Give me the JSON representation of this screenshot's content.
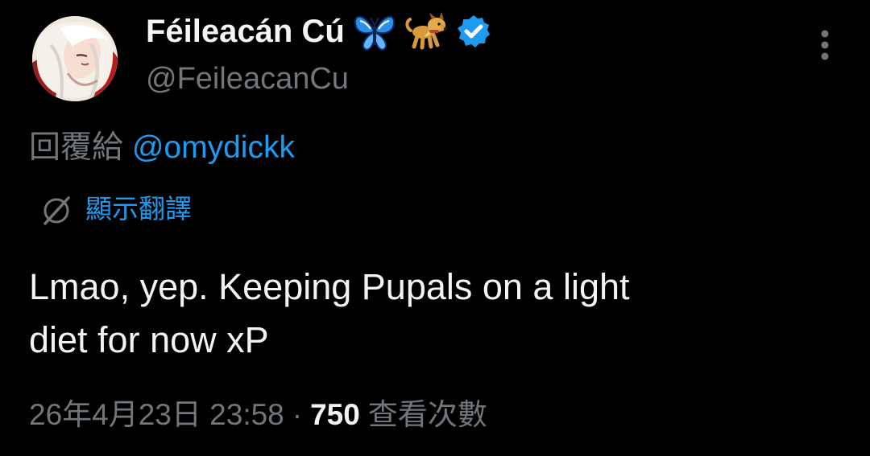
{
  "author": {
    "display_name": "Féileacán Cú",
    "handle": "@FeileacanCu",
    "name_badges": [
      "butterfly-icon",
      "dog-icon",
      "verified-badge-icon"
    ]
  },
  "reply": {
    "prefix": "回覆給 ",
    "mention": "@omydickk"
  },
  "translation": {
    "label": "顯示翻譯",
    "icon": "globe-slash-icon"
  },
  "tweet": {
    "text": "Lmao, yep. Keeping Pupals on a light\ndiet for now xP"
  },
  "meta": {
    "timestamp": "26年4月23日 23:58",
    "separator": "·",
    "view_count": "750",
    "view_label": "查看次數"
  },
  "colors": {
    "background": "#000000",
    "primary_text": "#e7e9ea",
    "secondary_text": "#71767b",
    "accent": "#1d9bf0"
  }
}
